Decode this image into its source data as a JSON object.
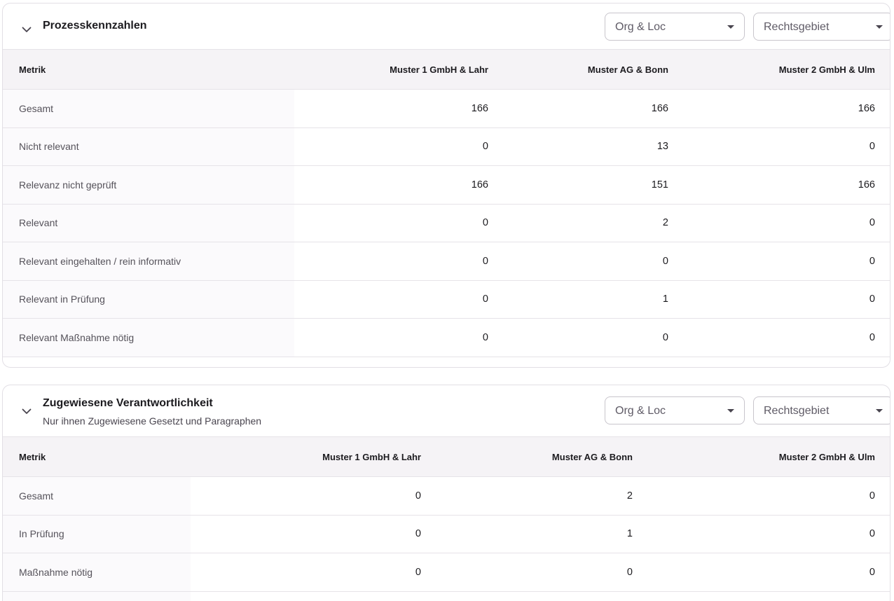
{
  "prozess": {
    "title": "Prozesskennzahlen",
    "filters": {
      "org_loc": "Org & Loc",
      "rechtsgebiet": "Rechtsgebiet"
    },
    "columns": [
      "Metrik",
      "Muster 1 GmbH & Lahr",
      "Muster AG & Bonn",
      "Muster 2 GmbH & Ulm"
    ],
    "rows": [
      {
        "label": "Gesamt",
        "values": [
          "166",
          "166",
          "166"
        ]
      },
      {
        "label": "Nicht relevant",
        "values": [
          "0",
          "13",
          "0"
        ]
      },
      {
        "label": "Relevanz nicht geprüft",
        "values": [
          "166",
          "151",
          "166"
        ]
      },
      {
        "label": "Relevant",
        "values": [
          "0",
          "2",
          "0"
        ]
      },
      {
        "label": "Relevant eingehalten / rein informativ",
        "values": [
          "0",
          "0",
          "0"
        ]
      },
      {
        "label": "Relevant in Prüfung",
        "values": [
          "0",
          "1",
          "0"
        ]
      },
      {
        "label": "Relevant Maßnahme nötig",
        "values": [
          "0",
          "0",
          "0"
        ]
      }
    ]
  },
  "verantwortung": {
    "title": "Zugewiesene Verantwortlichkeit",
    "subtitle": "Nur ihnen Zugewiesene Gesetzt und Paragraphen",
    "filters": {
      "org_loc": "Org & Loc",
      "rechtsgebiet": "Rechtsgebiet"
    },
    "columns": [
      "Metrik",
      "Muster 1 GmbH & Lahr",
      "Muster AG & Bonn",
      "Muster 2 GmbH & Ulm"
    ],
    "rows": [
      {
        "label": "Gesamt",
        "values": [
          "0",
          "2",
          "0"
        ]
      },
      {
        "label": "In Prüfung",
        "values": [
          "0",
          "1",
          "0"
        ]
      },
      {
        "label": "Maßnahme nötig",
        "values": [
          "0",
          "0",
          "0"
        ]
      },
      {
        "label": "",
        "values": [
          "",
          "",
          ""
        ]
      }
    ]
  },
  "icons": {
    "collapse": "chevron-down-icon",
    "dropdown": "caret-down-icon"
  }
}
